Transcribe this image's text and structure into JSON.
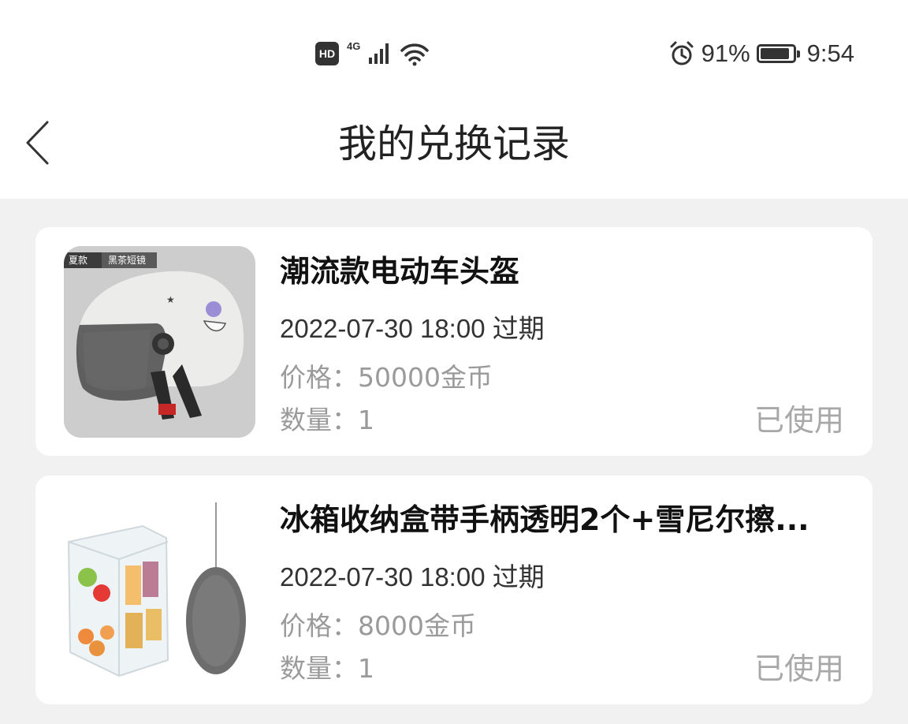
{
  "status_bar": {
    "hd": "HD",
    "network": "4G",
    "battery": "91%",
    "battery_level": 0.91,
    "time": "9:54"
  },
  "header": {
    "title": "我的兑换记录"
  },
  "records": [
    {
      "name": "潮流款电动车头盔",
      "date": "2022-07-30 18:00 过期",
      "price_label": "价格：",
      "price": "50000金币",
      "qty_label": "数量：",
      "qty": "1",
      "status": "已使用",
      "thumb_tags": [
        "夏款",
        "黑茶短镜"
      ]
    },
    {
      "name": "冰箱收纳盒带手柄透明2个+雪尼尔擦...",
      "date": "2022-07-30 18:00 过期",
      "price_label": "价格：",
      "price": "8000金币",
      "qty_label": "数量：",
      "qty": "1",
      "status": "已使用"
    }
  ]
}
